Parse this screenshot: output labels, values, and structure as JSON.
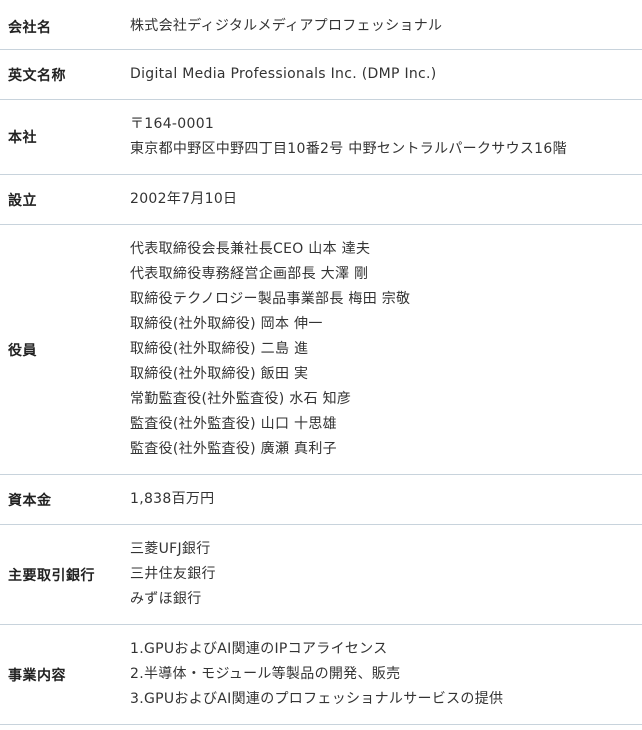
{
  "company_profile": {
    "rows": [
      {
        "label": "会社名",
        "lines": [
          "株式会社ディジタルメディアプロフェッショナル"
        ]
      },
      {
        "label": "英文名称",
        "lines": [
          "Digital Media Professionals Inc. (DMP Inc.)"
        ]
      },
      {
        "label": "本社",
        "lines": [
          "〒164-0001",
          "東京都中野区中野四丁目10番2号 中野セントラルパークサウス16階"
        ]
      },
      {
        "label": "設立",
        "lines": [
          "2002年7月10日"
        ]
      },
      {
        "label": "役員",
        "lines": [
          "代表取締役会長兼社長CEO 山本 達夫",
          "代表取締役専務経営企画部長 大澤 剛",
          "取締役テクノロジー製品事業部長 梅田 宗敬",
          "取締役(社外取締役) 岡本 伸一",
          "取締役(社外取締役) 二島 進",
          "取締役(社外取締役) 飯田 実",
          "常勤監査役(社外監査役) 水石 知彦",
          "監査役(社外監査役) 山口 十思雄",
          "監査役(社外監査役) 廣瀬 真利子"
        ]
      },
      {
        "label": "資本金",
        "lines": [
          "1,838百万円"
        ]
      },
      {
        "label": "主要取引銀行",
        "lines": [
          "三菱UFJ銀行",
          "三井住友銀行",
          "みずほ銀行"
        ]
      },
      {
        "label": "事業内容",
        "lines": [
          "1.GPUおよびAI関連のIPコアライセンス",
          "2.半導体・モジュール等製品の開発、販売",
          "3.GPUおよびAI関連のプロフェッショナルサービスの提供"
        ]
      }
    ]
  }
}
